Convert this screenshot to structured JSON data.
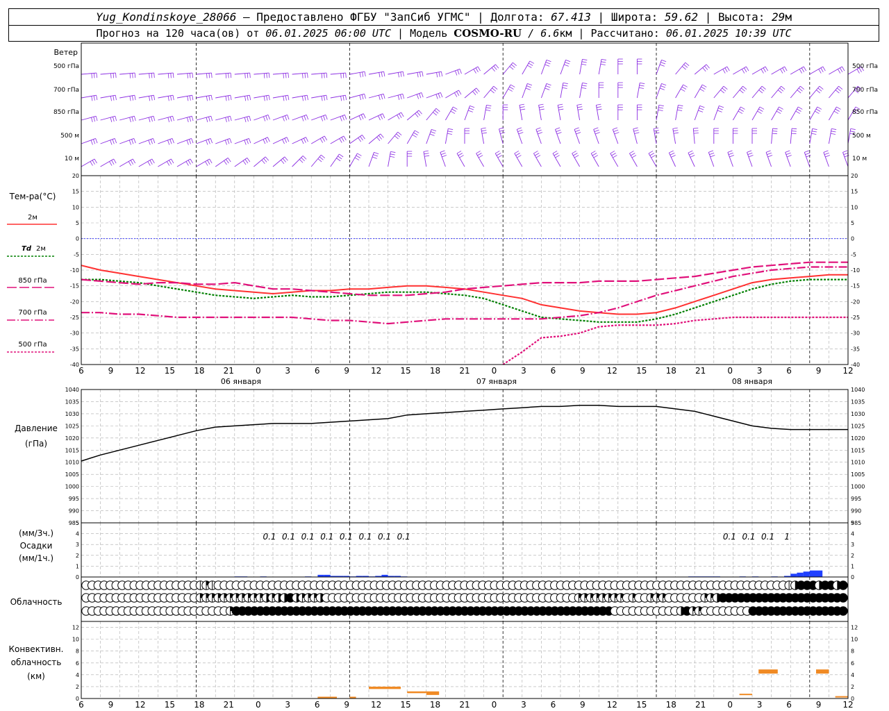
{
  "header": {
    "station": "Yug_Kondinskoye_28066",
    "provider": "– Предоставлено ФГБУ \"ЗапСиб УГМС\"",
    "lon_label": "Долгота:",
    "lon_value": "67.413",
    "lat_label": "Широта:",
    "lat_value": "59.62",
    "alt_label": "Высота:",
    "alt_value": "29",
    "alt_unit": "м",
    "forecast_label": "Прогноз на 120 часа(ов) от",
    "forecast_start": "06.01.2025 06:00 UTC",
    "model_label": "Модель",
    "model_name": "COSMO-RU",
    "model_res": "/ 6.6",
    "model_res_unit": "км",
    "calc_label": "Рассчитано:",
    "calc_time": "06.01.2025 10:39 UTC"
  },
  "time_axis": {
    "hours": [
      "6",
      "9",
      "12",
      "15",
      "18",
      "21",
      "0",
      "3",
      "6",
      "9",
      "12",
      "15",
      "18",
      "21",
      "0",
      "3",
      "6",
      "9",
      "12",
      "15",
      "18",
      "21",
      "0",
      "3",
      "6",
      "9",
      "12"
    ],
    "days": [
      "06 января",
      "07 января",
      "08 января"
    ]
  },
  "colors": {
    "wind": "#8a2be2",
    "t2m": "#ff3030",
    "td2m": "#008000",
    "t850": "#e0107a",
    "t700": "#e0107a",
    "t500": "#e0107a",
    "zero_line": "#2020ff",
    "precip": "#2040ff",
    "convective": "#f08a24",
    "pressure": "#000000",
    "grid": "#aaaaaa"
  },
  "chart_data": [
    {
      "type": "barbs",
      "title": "Ветер",
      "levels": [
        "500 гПа",
        "700 гПа",
        "850 гПа",
        "500 м",
        "10 м"
      ],
      "direction_deg": [
        [
          265,
          265,
          265,
          265,
          265,
          265,
          265,
          265,
          265,
          265,
          265,
          265,
          265,
          265,
          260,
          260,
          260,
          260,
          260,
          250,
          240,
          230,
          220,
          210,
          200,
          200,
          190,
          190,
          180,
          180,
          200,
          220,
          230,
          240,
          240,
          240,
          240,
          240,
          240,
          240,
          240
        ],
        [
          260,
          260,
          260,
          260,
          260,
          260,
          260,
          260,
          260,
          260,
          260,
          260,
          260,
          260,
          255,
          255,
          255,
          250,
          250,
          240,
          230,
          220,
          210,
          200,
          200,
          190,
          190,
          180,
          180,
          190,
          200,
          210,
          210,
          220,
          220,
          220,
          220,
          220,
          220,
          220,
          220
        ],
        [
          255,
          255,
          255,
          255,
          255,
          255,
          255,
          255,
          255,
          250,
          250,
          250,
          250,
          250,
          245,
          245,
          240,
          230,
          220,
          210,
          200,
          190,
          180,
          170,
          170,
          170,
          170,
          170,
          180,
          180,
          190,
          190,
          200,
          200,
          210,
          210,
          210,
          210,
          210,
          210,
          210
        ],
        [
          250,
          250,
          250,
          250,
          250,
          250,
          250,
          250,
          250,
          245,
          245,
          245,
          240,
          240,
          235,
          230,
          220,
          210,
          200,
          190,
          180,
          170,
          165,
          160,
          160,
          160,
          160,
          160,
          160,
          165,
          170,
          170,
          175,
          180,
          180,
          180,
          185,
          185,
          190,
          190,
          190
        ],
        [
          240,
          240,
          240,
          240,
          240,
          240,
          240,
          235,
          235,
          230,
          230,
          225,
          220,
          215,
          210,
          200,
          190,
          180,
          170,
          160,
          150,
          150,
          150,
          150,
          150,
          150,
          150,
          150,
          150,
          150,
          150,
          155,
          155,
          160,
          160,
          160,
          160,
          160,
          160,
          160,
          160
        ]
      ]
    },
    {
      "type": "line",
      "title": "Тем-ра(°С)",
      "x": [
        0,
        3,
        6,
        9,
        12,
        15,
        18,
        21,
        24,
        27,
        30,
        33,
        36,
        39,
        42,
        45,
        48,
        51,
        54,
        57,
        60,
        63,
        66,
        69,
        72,
        75,
        78,
        81,
        84,
        87,
        90,
        93,
        96,
        99,
        102,
        105,
        108,
        111,
        114,
        117,
        120
      ],
      "ylim": [
        -40,
        20
      ],
      "series": [
        {
          "name": "2м",
          "style": "solid",
          "values": [
            -8.5,
            -10,
            -11,
            -12,
            -13,
            -14,
            -15,
            -16,
            -16.5,
            -17,
            -17.5,
            -17,
            -16.5,
            -16.5,
            -16,
            -16,
            -15.5,
            -15,
            -15,
            -15.5,
            -16,
            -17,
            -18,
            -19,
            -21,
            -22,
            -23,
            -23.5,
            -24,
            -24,
            -23.5,
            -22,
            -20,
            -18,
            -16,
            -14,
            -13,
            -12.5,
            -12,
            -11.5,
            -11.5
          ]
        },
        {
          "name": "Td 2м",
          "style": "dotted",
          "values": [
            -13,
            -13,
            -13.5,
            -14,
            -15,
            -16,
            -17,
            -18,
            -18.5,
            -19,
            -18.5,
            -18,
            -18.5,
            -18.5,
            -18,
            -17.5,
            -17,
            -17,
            -17,
            -17.5,
            -18,
            -19,
            -21,
            -23,
            -25,
            -25.5,
            -26,
            -26.5,
            -26.5,
            -26.5,
            -25.5,
            -24,
            -22,
            -20,
            -18,
            -16,
            -14.5,
            -13.5,
            -13,
            -13,
            -13
          ]
        },
        {
          "name": "850 гПа",
          "style": "dashed",
          "values": [
            -13,
            -13.5,
            -14,
            -14.5,
            -14,
            -14,
            -14.5,
            -14.5,
            -14,
            -15,
            -16,
            -16,
            -16.5,
            -17,
            -17.5,
            -18,
            -18,
            -18,
            -17.5,
            -17,
            -16,
            -15.5,
            -15,
            -14.5,
            -14,
            -14,
            -14,
            -13.5,
            -13.5,
            -13.5,
            -13,
            -12.5,
            -12,
            -11,
            -10,
            -9,
            -8.5,
            -8,
            -7.5,
            -7.5,
            -7.5
          ]
        },
        {
          "name": "700 гПа",
          "style": "dashdot",
          "values": [
            -23.5,
            -23.5,
            -24,
            -24,
            -24.5,
            -25,
            -25,
            -25,
            -25,
            -25,
            -25,
            -25,
            -25.5,
            -26,
            -26,
            -26.5,
            -27,
            -26.5,
            -26,
            -25.5,
            -25.5,
            -25.5,
            -25.5,
            -25.5,
            -25.5,
            -25,
            -24.5,
            -23.5,
            -22,
            -20,
            -18,
            -16.5,
            -15,
            -13.5,
            -12,
            -11,
            -10,
            -9.5,
            -9,
            -9,
            -9
          ]
        },
        {
          "name": "500 гПа",
          "style": "dotted",
          "values": [
            null,
            null,
            null,
            null,
            null,
            null,
            null,
            null,
            null,
            null,
            null,
            null,
            null,
            null,
            null,
            null,
            null,
            null,
            null,
            null,
            null,
            null,
            -40,
            -36,
            -31.5,
            -31,
            -30,
            -28,
            -27.5,
            -27.5,
            -27.5,
            -27,
            -26,
            -25.5,
            -25,
            -25,
            -25,
            -25,
            -25,
            -25,
            -25
          ]
        }
      ]
    },
    {
      "type": "line",
      "title": "Давление",
      "ylabel": "(гПа)",
      "ylim": [
        985,
        1040
      ],
      "x": [
        0,
        3,
        6,
        9,
        12,
        15,
        18,
        21,
        24,
        27,
        30,
        33,
        36,
        39,
        42,
        45,
        48,
        51,
        54,
        57,
        60,
        63,
        66,
        69,
        72,
        75,
        78,
        81,
        84,
        87,
        90,
        93,
        96,
        99,
        102,
        105,
        108,
        111,
        114,
        117,
        120
      ],
      "series": [
        {
          "name": "",
          "values": [
            1010.5,
            1013,
            1015,
            1017,
            1019,
            1021,
            1023,
            1024.5,
            1025,
            1025.5,
            1026,
            1026,
            1026,
            1026.5,
            1027,
            1027.5,
            1028,
            1029.5,
            1030,
            1030.5,
            1031,
            1031.5,
            1032,
            1032.5,
            1033,
            1033,
            1033.5,
            1033.5,
            1033,
            1033,
            1033,
            1032,
            1031,
            1029,
            1027,
            1025,
            1024,
            1023.5,
            1023.5,
            1023.5,
            1023.5
          ]
        }
      ]
    },
    {
      "type": "bar",
      "title": "Осадки",
      "ylabel_top": "(мм/3ч.)",
      "ylabel_bottom": "(мм/1ч.)",
      "ylim": [
        0,
        5
      ],
      "labels": [
        {
          "x": 30,
          "text": "0.1"
        },
        {
          "x": 33,
          "text": "0.1"
        },
        {
          "x": 36,
          "text": "0.1"
        },
        {
          "x": 39,
          "text": "0.1"
        },
        {
          "x": 42,
          "text": "0.1"
        },
        {
          "x": 45,
          "text": "0.1"
        },
        {
          "x": 48,
          "text": "0.1"
        },
        {
          "x": 51,
          "text": "0.1"
        },
        {
          "x": 102,
          "text": "0.1"
        },
        {
          "x": 105,
          "text": "0.1"
        },
        {
          "x": 108,
          "text": "0.1"
        },
        {
          "x": 111,
          "text": "1"
        }
      ],
      "hourly": [
        {
          "x": 25,
          "v": 0.05
        },
        {
          "x": 26,
          "v": 0.05
        },
        {
          "x": 29,
          "v": 0.05
        },
        {
          "x": 36,
          "v": 0.05
        },
        {
          "x": 38,
          "v": 0.2
        },
        {
          "x": 39,
          "v": 0.2
        },
        {
          "x": 40,
          "v": 0.1
        },
        {
          "x": 41,
          "v": 0.1
        },
        {
          "x": 42,
          "v": 0.1
        },
        {
          "x": 43,
          "v": 0.05
        },
        {
          "x": 44,
          "v": 0.1
        },
        {
          "x": 45,
          "v": 0.1
        },
        {
          "x": 46,
          "v": 0.05
        },
        {
          "x": 47,
          "v": 0.1
        },
        {
          "x": 48,
          "v": 0.2
        },
        {
          "x": 49,
          "v": 0.1
        },
        {
          "x": 50,
          "v": 0.1
        },
        {
          "x": 51,
          "v": 0.05
        },
        {
          "x": 96,
          "v": 0.05
        },
        {
          "x": 97,
          "v": 0.05
        },
        {
          "x": 98,
          "v": 0.05
        },
        {
          "x": 99,
          "v": 0.05
        },
        {
          "x": 100,
          "v": 0.05
        },
        {
          "x": 104,
          "v": 0.05
        },
        {
          "x": 106,
          "v": 0.05
        },
        {
          "x": 109,
          "v": 0.05
        },
        {
          "x": 111,
          "v": 0.1
        },
        {
          "x": 112,
          "v": 0.3
        },
        {
          "x": 113,
          "v": 0.4
        },
        {
          "x": 114,
          "v": 0.5
        },
        {
          "x": 115,
          "v": 0.6
        },
        {
          "x": 116,
          "v": 0.6
        }
      ]
    },
    {
      "type": "table",
      "title": "Облачность",
      "rows": [
        "0000000000000000000121000000000000000000000000000000000000000000000000000000000000000000000000000000000000000000000001344434434",
        "0000000000000000000222222222223233432223000000000000000000000000000000000000000000222222220200222000000223444444444444444444444",
        "0000000000000000000000002444444444444444444444444444444444444444444444444444444444444444000000000003422000000004444444444444444"
      ]
    },
    {
      "type": "bar",
      "title": "Конвективн. облачность",
      "ylabel": "(км)",
      "ylim": [
        0,
        13
      ],
      "segments": [
        {
          "x0": 37,
          "x1": 40,
          "base": 0.1,
          "top": 0.3
        },
        {
          "x0": 42,
          "x1": 43,
          "base": 0.1,
          "top": 0.3
        },
        {
          "x0": 45,
          "x1": 50,
          "base": 1.6,
          "top": 2.0
        },
        {
          "x0": 51,
          "x1": 54,
          "base": 0.9,
          "top": 1.2
        },
        {
          "x0": 54,
          "x1": 56,
          "base": 0.6,
          "top": 1.2
        },
        {
          "x0": 103,
          "x1": 105,
          "base": 0.6,
          "top": 0.8
        },
        {
          "x0": 106,
          "x1": 109,
          "base": 4.2,
          "top": 4.9
        },
        {
          "x0": 115,
          "x1": 117,
          "base": 4.2,
          "top": 4.9
        },
        {
          "x0": 118,
          "x1": 120,
          "base": 0.2,
          "top": 0.4
        }
      ]
    }
  ],
  "labels": {
    "wind_title": "Ветер",
    "temp_title": "Тем-ра(°С)",
    "legend_2m": "2м",
    "legend_td": "Td",
    "legend_td_lvl": "2м",
    "legend_850": "850 гПа",
    "legend_700": "700 гПа",
    "legend_500": "500 гПа",
    "pres_title": "Давление",
    "pres_unit": "(гПа)",
    "precip_u1": "(мм/3ч.)",
    "precip_title": "Осадки",
    "precip_u2": "(мм/1ч.)",
    "cloud_title": "Облачность",
    "conv_title1": "Конвективн.",
    "conv_title2": "облачность",
    "conv_unit": "(км)"
  }
}
